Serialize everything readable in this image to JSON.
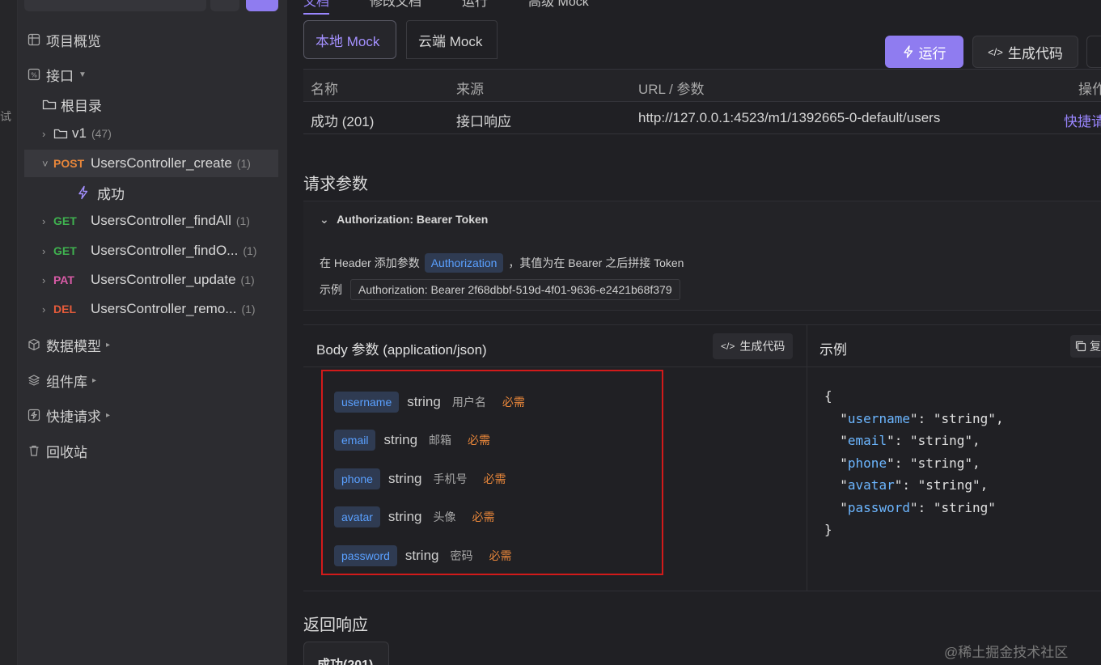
{
  "sidebar": {
    "rail_char": "试",
    "nav": {
      "overview": "项目概览",
      "api": "接口",
      "models": "数据模型",
      "components": "组件库",
      "quick": "快捷请求",
      "trash": "回收站"
    },
    "tree": {
      "root": "根目录",
      "folder": "v1",
      "folder_count": "(47)",
      "items": [
        {
          "method": "POST",
          "name": "UsersController_create",
          "count": "(1)"
        },
        {
          "method": "GET",
          "name": "UsersController_findAll",
          "count": "(1)"
        },
        {
          "method": "GET",
          "name": "UsersController_findO...",
          "count": "(1)"
        },
        {
          "method": "PAT",
          "name": "UsersController_update",
          "count": "(1)"
        },
        {
          "method": "DEL",
          "name": "UsersController_remo...",
          "count": "(1)"
        }
      ],
      "child": "成功"
    }
  },
  "main": {
    "top_tabs": [
      "文档",
      "修改文档",
      "运行",
      "高级 Mock"
    ],
    "mock_tabs": {
      "local": "本地 Mock",
      "cloud": "云端 Mock"
    },
    "run_btn": "运行",
    "gen_btn": "生成代码",
    "mock_table": {
      "headers": [
        "名称",
        "来源",
        "URL / 参数",
        "操作"
      ],
      "row": {
        "name": "成功 (201)",
        "source": "接口响应",
        "url": "http://127.0.0.1:4523/m1/1392665-0-default/users",
        "action": "快捷请"
      }
    },
    "req_title": "请求参数",
    "auth": {
      "title": "Authorization: Bearer Token",
      "line_prefix": "在 Header 添加参数",
      "param": "Authorization",
      "line_suffix": "，其值为在 Bearer 之后拼接 Token",
      "example_label": "示例",
      "example_value": "Authorization: Bearer 2f68dbbf-519d-4f01-9636-e2421b68f379"
    },
    "body": {
      "title": "Body 参数 (application/json)",
      "gen_btn": "生成代码",
      "example_title": "示例",
      "copy_label": "复",
      "fields": [
        {
          "name": "username",
          "type": "string",
          "desc": "用户名",
          "req": "必需"
        },
        {
          "name": "email",
          "type": "string",
          "desc": "邮箱",
          "req": "必需"
        },
        {
          "name": "phone",
          "type": "string",
          "desc": "手机号",
          "req": "必需"
        },
        {
          "name": "avatar",
          "type": "string",
          "desc": "头像",
          "req": "必需"
        },
        {
          "name": "password",
          "type": "string",
          "desc": "密码",
          "req": "必需"
        }
      ],
      "json_lines": [
        {
          "key": "username",
          "value": "\"string\","
        },
        {
          "key": "email",
          "value": "\"string\","
        },
        {
          "key": "phone",
          "value": "\"string\","
        },
        {
          "key": "avatar",
          "value": "\"string\","
        },
        {
          "key": "password",
          "value": "\"string\""
        }
      ]
    },
    "resp_title": "返回响应",
    "resp_tab": "成功(201)",
    "watermark": "@稀土掘金技术社区"
  }
}
